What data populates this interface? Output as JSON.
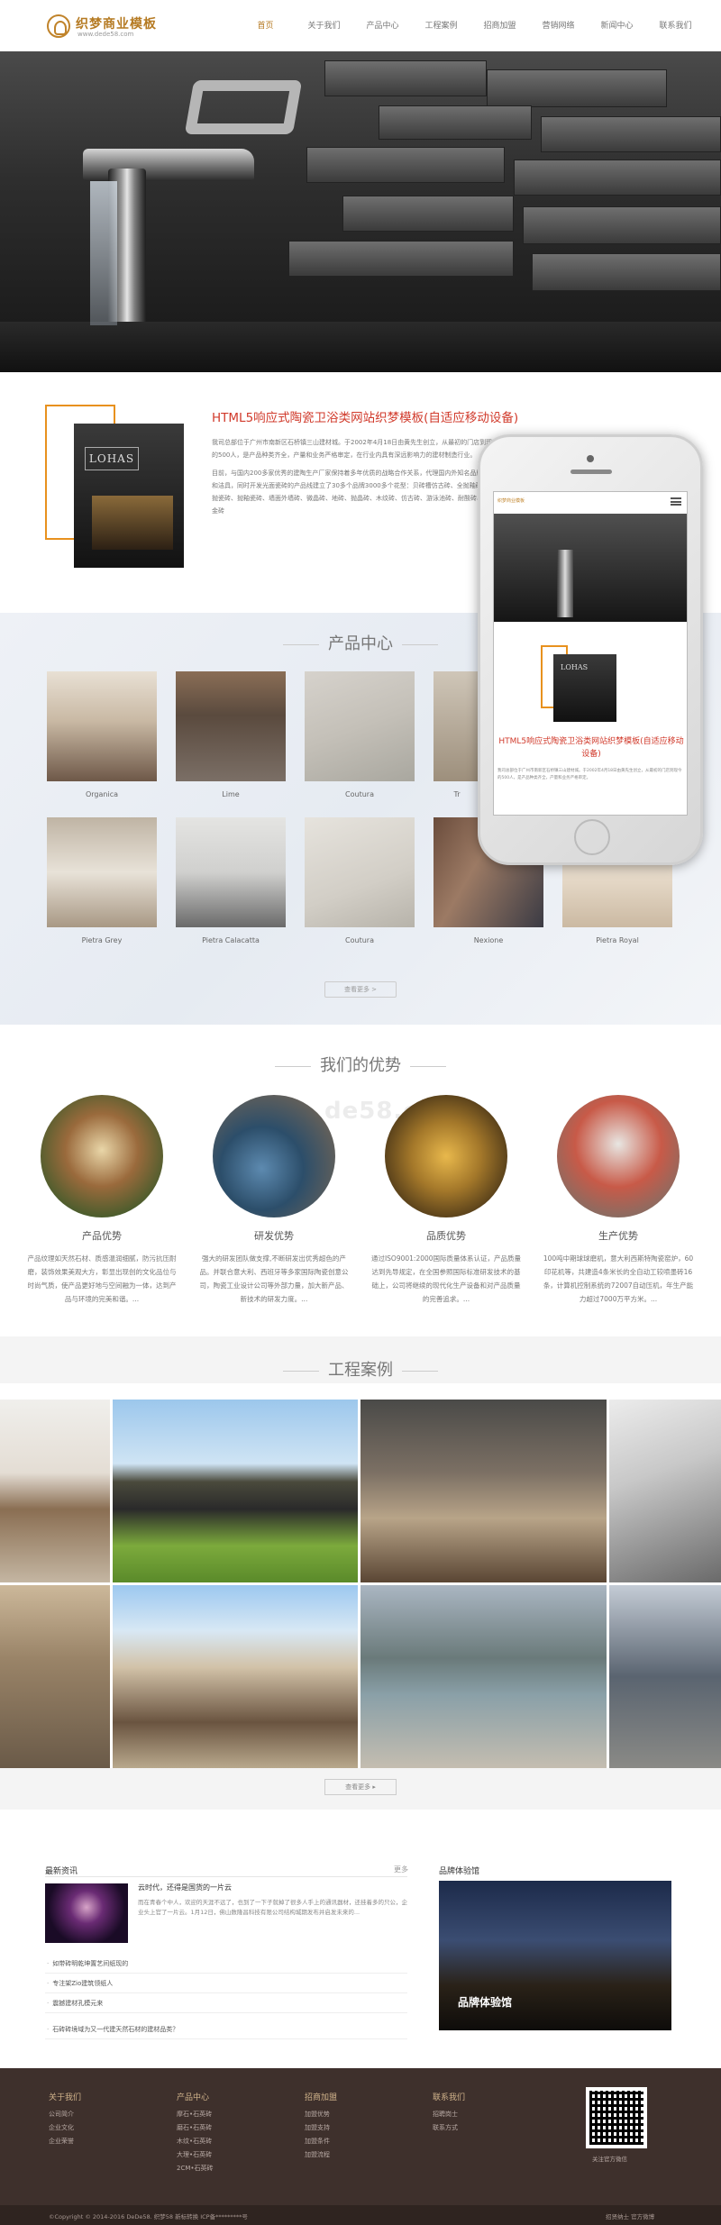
{
  "header": {
    "logo_title": "织梦商业模板",
    "logo_url": "www.dede58.com",
    "nav": [
      "首页",
      "关于我们",
      "产品中心",
      "工程案例",
      "招商加盟",
      "营销网络",
      "新闻中心",
      "联系我们"
    ],
    "active_nav": 0
  },
  "about": {
    "title": "HTML5响应式陶瓷卫浴类网站织梦模板(自适应移动设备)",
    "paragraph1": "我司总部位于广州市南新区石桥镇三山建材城。于2002年4月18日由黄先生创立，从最初的门店到现今的500人，是产品种类齐全，产量和业务严格审定，在行业内具有深远影响力的建材制造行业。",
    "paragraph2": "目前，与国内200多家优秀的建陶生产厂家保持着多年优质的战略合作关系，代理国内外知名品牌瓷砖和洁具，同时开发光面瓷砖的产品线建立了30多个品牌3000多个花型：贝砖槽仿古砖、全抛釉砖、全抛瓷砖、抛釉瓷砖、墙面外墙砖、微晶砖、地砖、抛晶砖、木纹砖、仿古砖、游泳池砖、耐酸砖、钛合金砖",
    "logo_sign": "LOHAS",
    "phone_brand": "织梦商业模板",
    "phone_title": "HTML5响应式陶瓷卫浴类网站织梦模板(自适应移动设备)",
    "phone_text": "我司总部位于广州市南新区石桥镇三山建材城。于2002年4月18日由黄先生创立，从最初的门店到现今的500人，是产品种类齐全，产量和业务严格审定。"
  },
  "products": {
    "title": "产品中心",
    "items": [
      "Organica",
      "Lime",
      "Coutura",
      "Tr",
      "Pietra Grey",
      "Pietra Calacatta",
      "Coutura",
      "Nexione",
      "Pietra Royal"
    ],
    "more_label": "查看更多 >"
  },
  "advantages": {
    "title": "我们的优势",
    "watermark": "de58.com",
    "items": [
      {
        "title": "产品优势",
        "text": "产品纹理如天然石材、质感温润细腻，防污抗压耐磨，装饰效果美观大方，彰显出现创的文化品位与时尚气质，使产品更好地与空间融为一体，达到产品与环境的完美和谐。..."
      },
      {
        "title": "研发优势",
        "text": "强大的研发团队做支撑,不断研发出优秀超色的产品。并联合意大利、西班牙等多家国际陶瓷创意公司，陶瓷工业设计公司等外部力量，加大新产品、新技术的研发力度。..."
      },
      {
        "title": "品质优势",
        "text": "通过ISO9001:2000国际质量体系认证，产品质量达到先导规定，在全国参照国际标准研发技术的基础上，公司将继续的现代化生产设备和对产品质量的完善追求。..."
      },
      {
        "title": "生产优势",
        "text": "100吨中期球球磨机，意大利西斯特陶瓷窑炉，60印花机等，共建造4条米长的全自动工较喷墨砖16条，计算机控制系统的72007自动压机，年生产能力超过7000万平方米。..."
      }
    ]
  },
  "cases": {
    "title": "工程案例",
    "more_label": "查看更多 ▸"
  },
  "news": {
    "heading": "最新资讯",
    "more": "更多",
    "featured_title": "云时代，还得是国货的一片云",
    "featured_desc": "而在青春个中人，欢迎的天涯不远了，也到了一下子就掉了很多人手上的通讯器材，还挂着多的只公，企业头上官了一片云。1月12日，佛山数隆昌科技有限公司结构城期发布并启发未来的...",
    "items": [
      "如带砖明乾坤置艺间纸现的",
      "专注架Zio建筑领纸人",
      "震撼建材孔模元来",
      "石砖砖境域为又一代建天然石材的建材品类？"
    ],
    "brand_heading": "品牌体验馆",
    "brand_label": "品牌体验馆"
  },
  "footer": {
    "cols": [
      {
        "heading": "关于我们",
        "items": [
          "公司简介",
          "企业文化",
          "企业荣誉"
        ]
      },
      {
        "heading": "产品中心",
        "items": [
          "摩石•石英砖",
          "磨石•石英砖",
          "木纹•石英砖",
          "大理•石英砖",
          "2CM•石英砖"
        ]
      },
      {
        "heading": "招商加盟",
        "items": [
          "加盟优势",
          "加盟支持",
          "加盟条件",
          "加盟流程"
        ]
      },
      {
        "heading": "联系我们",
        "items": [
          "招聘岗士",
          "联系方式"
        ]
      }
    ],
    "qr_label": "关注官方微信",
    "copyright": "©Copyright © 2014-2016 DeDe58. 织梦58 新标转换    ICP备*********号",
    "links": "招贤纳士    官方微博"
  }
}
